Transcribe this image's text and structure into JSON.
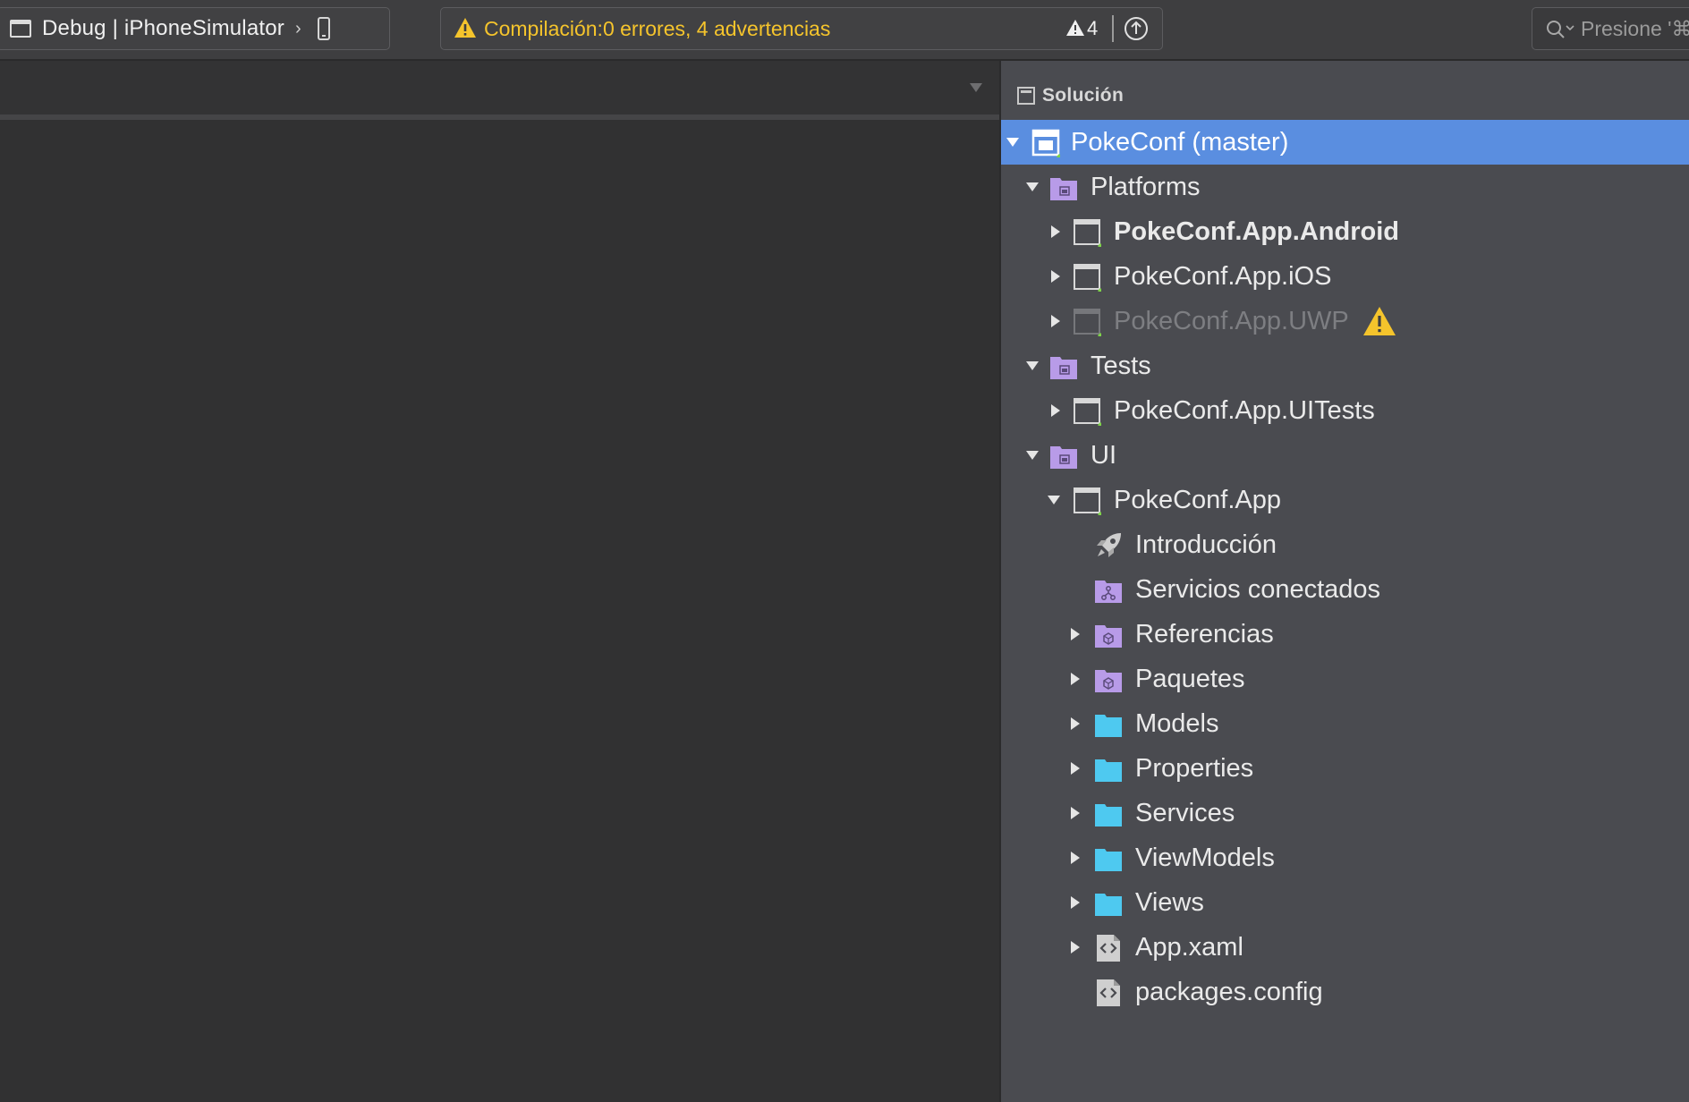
{
  "toolbar": {
    "config_label": "Debug | iPhoneSimulator",
    "status_text": "Compilación:0 errores, 4 advertencias",
    "warning_count": "4",
    "search_placeholder": "Presione '⌘."
  },
  "solution_pad": {
    "title": "Solución",
    "items": [
      {
        "label": "PokeConf (master)",
        "icon": "solution-icon"
      },
      {
        "label": "Platforms",
        "icon": "solution-folder-icon"
      },
      {
        "label": "PokeConf.App.Android",
        "icon": "project-icon"
      },
      {
        "label": "PokeConf.App.iOS",
        "icon": "project-icon"
      },
      {
        "label": "PokeConf.App.UWP",
        "icon": "project-icon"
      },
      {
        "label": "Tests",
        "icon": "solution-folder-icon"
      },
      {
        "label": "PokeConf.App.UITests",
        "icon": "project-icon"
      },
      {
        "label": "UI",
        "icon": "solution-folder-icon"
      },
      {
        "label": "PokeConf.App",
        "icon": "project-icon"
      },
      {
        "label": "Introducción",
        "icon": "rocket-icon"
      },
      {
        "label": "Servicios conectados",
        "icon": "connected-services-icon"
      },
      {
        "label": "Referencias",
        "icon": "references-folder-icon"
      },
      {
        "label": "Paquetes",
        "icon": "packages-folder-icon"
      },
      {
        "label": "Models",
        "icon": "folder-icon"
      },
      {
        "label": "Properties",
        "icon": "folder-icon"
      },
      {
        "label": "Services",
        "icon": "folder-icon"
      },
      {
        "label": "ViewModels",
        "icon": "folder-icon"
      },
      {
        "label": "Views",
        "icon": "folder-icon"
      },
      {
        "label": "App.xaml",
        "icon": "xml-file-icon"
      },
      {
        "label": "packages.config",
        "icon": "xml-file-icon"
      }
    ]
  },
  "colors": {
    "status_warning": "#f5c42c",
    "selection": "#5a8ee0",
    "folder": "#4ec9f0",
    "solution_folder": "#b89be8"
  }
}
